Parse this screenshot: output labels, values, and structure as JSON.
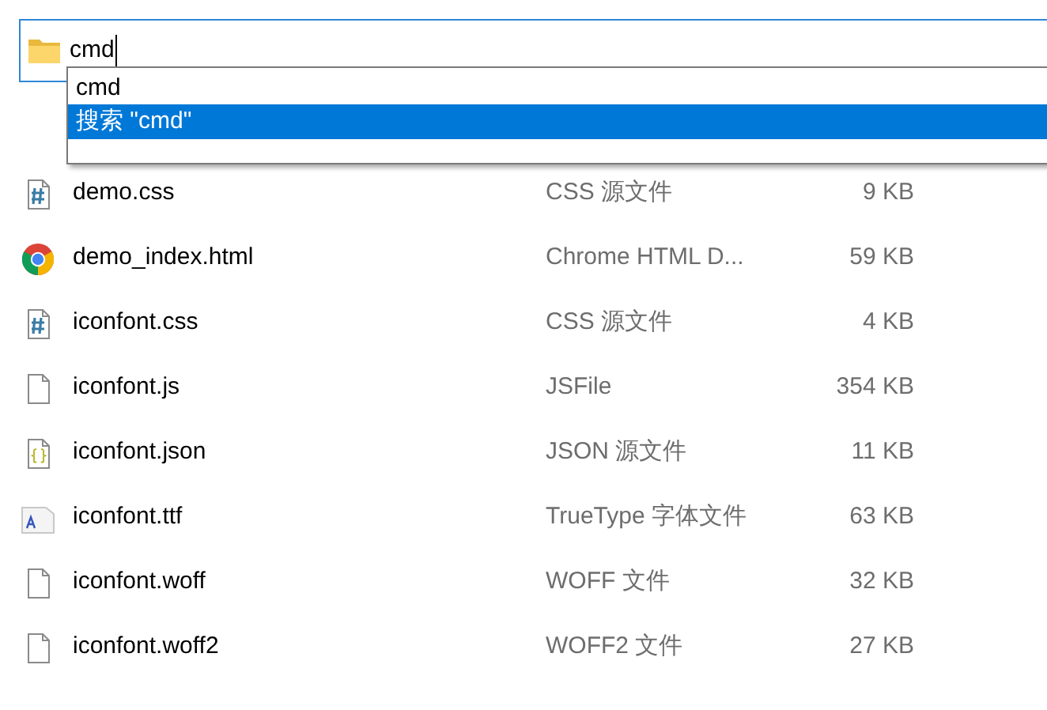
{
  "address_bar": {
    "value": "cmd"
  },
  "suggestions": [
    {
      "label": "cmd",
      "selected": false
    },
    {
      "label": "搜索 \"cmd\"",
      "selected": true
    }
  ],
  "files": [
    {
      "name": "demo.css",
      "kind": "css",
      "type": "CSS 源文件",
      "size": "9 KB"
    },
    {
      "name": "demo_index.html",
      "kind": "chrome",
      "type": "Chrome HTML D...",
      "size": "59 KB"
    },
    {
      "name": "iconfont.css",
      "kind": "css",
      "type": "CSS 源文件",
      "size": "4 KB"
    },
    {
      "name": "iconfont.js",
      "kind": "blank",
      "type": "JSFile",
      "size": "354 KB"
    },
    {
      "name": "iconfont.json",
      "kind": "json",
      "type": "JSON 源文件",
      "size": "11 KB"
    },
    {
      "name": "iconfont.ttf",
      "kind": "font",
      "type": "TrueType 字体文件",
      "size": "63 KB"
    },
    {
      "name": "iconfont.woff",
      "kind": "blank",
      "type": "WOFF 文件",
      "size": "32 KB"
    },
    {
      "name": "iconfont.woff2",
      "kind": "blank",
      "type": "WOFF2 文件",
      "size": "27 KB"
    }
  ]
}
